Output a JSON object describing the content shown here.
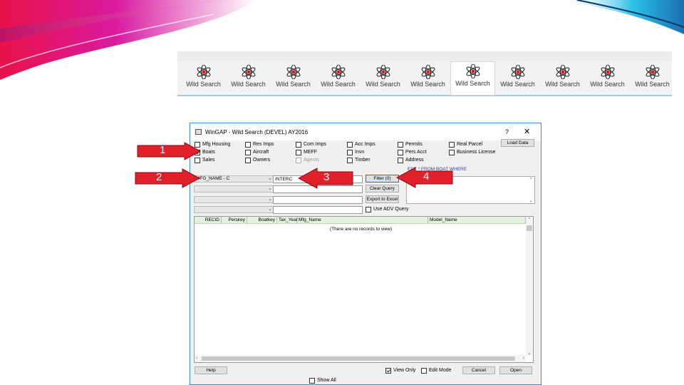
{
  "toolbar": {
    "buttons": [
      {
        "label": "Wild Search"
      },
      {
        "label": "Wild Search"
      },
      {
        "label": "Wild Search"
      },
      {
        "label": "Wild Search"
      },
      {
        "label": "Wild Search"
      },
      {
        "label": "Wild Search"
      },
      {
        "label": "Wild Search"
      },
      {
        "label": "Wild Search"
      },
      {
        "label": "Wild Search"
      },
      {
        "label": "Wild Search"
      },
      {
        "label": "Wild Search"
      }
    ]
  },
  "window": {
    "title": "WinGAP - Wild Search (DEVEL) AY2016",
    "help_glyph": "?",
    "close_glyph": "✕",
    "checkboxes": [
      {
        "label": "Mfg Housing",
        "checked": false
      },
      {
        "label": "Res Imps",
        "checked": false
      },
      {
        "label": "Com Imps",
        "checked": false
      },
      {
        "label": "Acc Imps",
        "checked": false
      },
      {
        "label": "Permits",
        "checked": false
      },
      {
        "label": "Real Parcel",
        "checked": false
      },
      {
        "label": "Boats",
        "checked": true
      },
      {
        "label": "Aircraft",
        "checked": false
      },
      {
        "label": "MEFF",
        "checked": false
      },
      {
        "label": "Invn",
        "checked": false
      },
      {
        "label": "Pers Acct",
        "checked": false
      },
      {
        "label": "Business License",
        "checked": false
      },
      {
        "label": "Sales",
        "checked": false
      },
      {
        "label": "Owners",
        "checked": false
      },
      {
        "label": "Agents",
        "checked": false,
        "disabled": true
      },
      {
        "label": "Timber",
        "checked": false
      },
      {
        "label": "Address",
        "checked": false
      }
    ],
    "load_data_label": "Load Data",
    "sql_text": "ECT * FROM BOAT WHERE",
    "field_combos": [
      {
        "value": "MFG_NAME - C"
      },
      {
        "value": ""
      },
      {
        "value": ""
      },
      {
        "value": ""
      }
    ],
    "value_fields": [
      {
        "value": "INTERC"
      },
      {
        "value": ""
      },
      {
        "value": ""
      },
      {
        "value": ""
      }
    ],
    "filter_label": "Filter (0)",
    "clear_query_label": "Clear Query",
    "export_label": "Export to Excel",
    "use_adv_query_label": "Use ADV Query",
    "grid": {
      "columns": [
        "RECID",
        "Perskey",
        "Boatkey",
        "Tax_Year",
        "Mfg_Name",
        "Model_Name"
      ],
      "empty_message": "(There are no records to view)"
    },
    "help_label": "Help",
    "view_only_label": "View Only",
    "edit_mode_label": "Edit Mode",
    "cancel_label": "Cancel",
    "open_label": "Open",
    "show_all_label": "Show All"
  },
  "callouts": [
    {
      "number": "1"
    },
    {
      "number": "2"
    },
    {
      "number": "3"
    },
    {
      "number": "4"
    }
  ],
  "colors": {
    "callout_red": "#e0202a",
    "window_border": "#3c8bd6",
    "grid_header": "#e3f2e0",
    "swoosh_magenta": "#e0147a",
    "swoosh_cyan": "#2bc1e8"
  }
}
